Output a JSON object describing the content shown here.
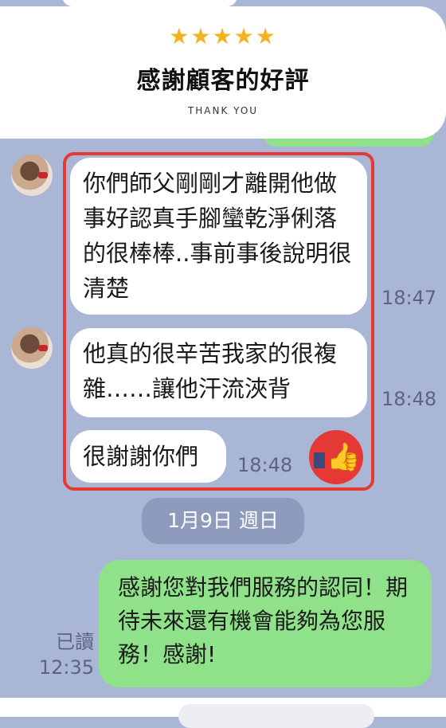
{
  "banner": {
    "stars": "★★★★★",
    "title": "感謝顧客的好評",
    "subtitle": "THANK YOU",
    "star_color": "#f3b21e"
  },
  "chat": {
    "messages": [
      {
        "sender": "customer",
        "text": "你們師父剛剛才離開他做事好認真手腳蠻乾淨俐落的很棒棒..事前事後說明很清楚",
        "time": "18:47"
      },
      {
        "sender": "customer",
        "text": "他真的很辛苦我家的很複雜……讓他汗流浹背",
        "time": "18:48"
      },
      {
        "sender": "customer",
        "text": "很謝謝你們",
        "time": "18:48"
      }
    ],
    "date_separator": "1月9日 週日",
    "reply": {
      "text": "感謝您對我們服務的認同！期待未來還有機會能夠為您服務！感謝!",
      "read_label": "已讀",
      "time": "12:35"
    }
  },
  "icons": {
    "thumb": "thumbs-up-icon"
  },
  "colors": {
    "chat_background": "#aab6d6",
    "highlight": "#e53935",
    "reply_bubble": "#8fe28a"
  }
}
